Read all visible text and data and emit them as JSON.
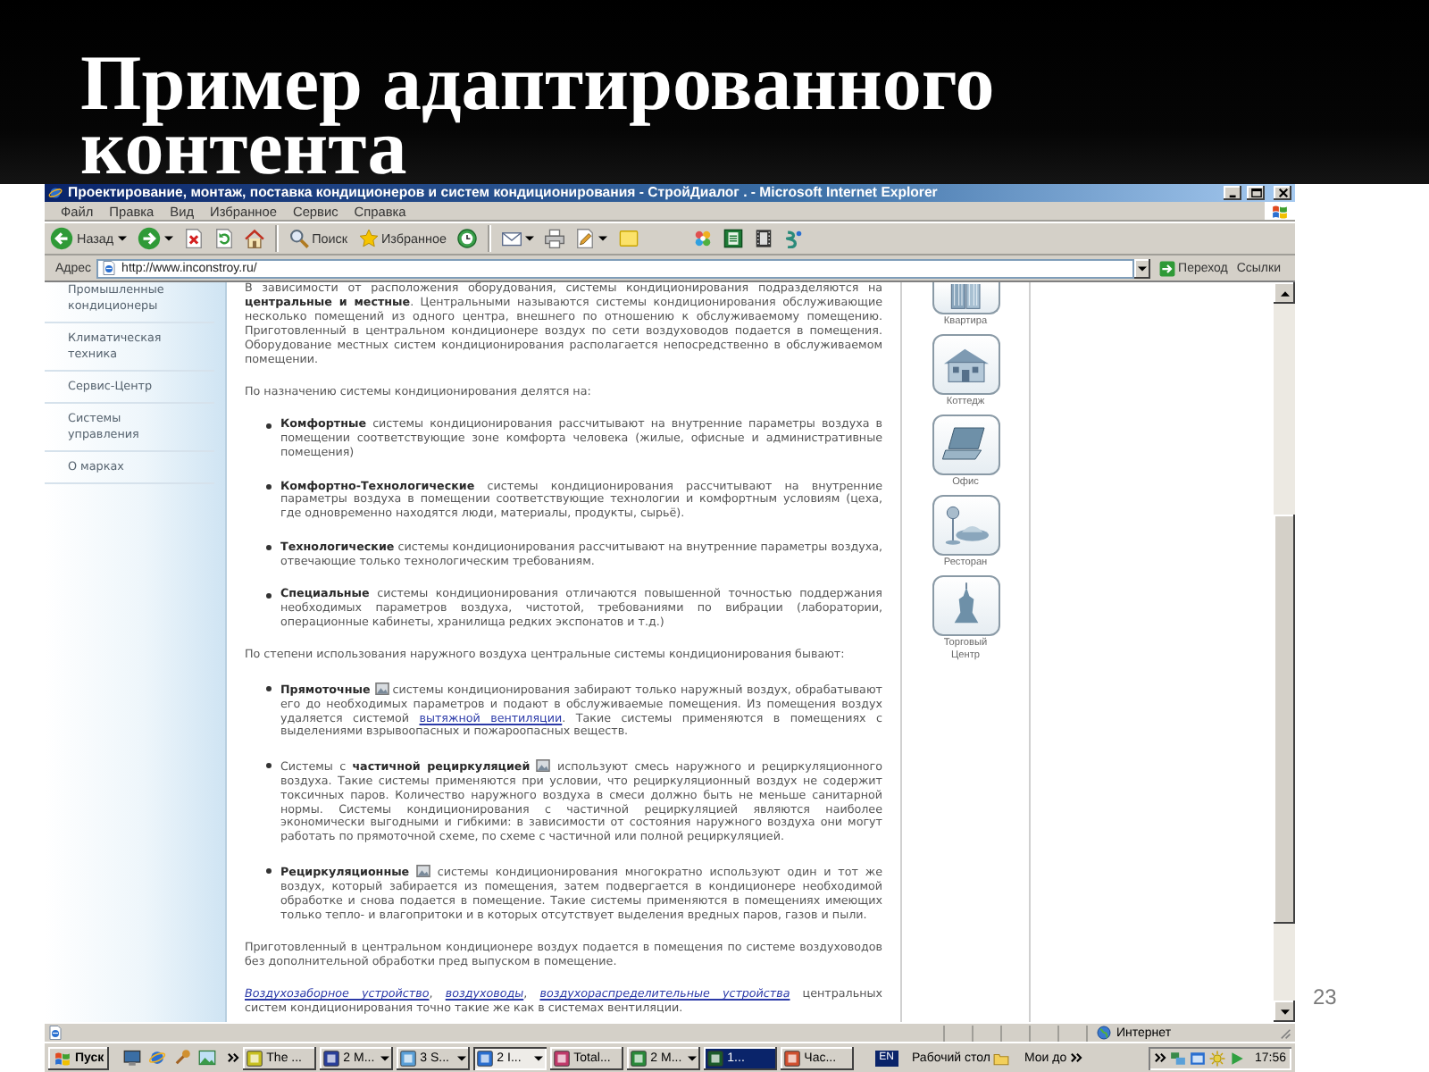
{
  "slide": {
    "title": "Пример адаптированного контента",
    "page_number": "23"
  },
  "browser": {
    "title": "Проектирование, монтаж, поставка кондиционеров и систем кондиционирования - СтройДиалог . - Microsoft Internet Explorer",
    "menu": [
      "Файл",
      "Правка",
      "Вид",
      "Избранное",
      "Сервис",
      "Справка"
    ],
    "toolbar": {
      "back": "Назад",
      "search": "Поиск",
      "favorites": "Избранное"
    },
    "address_bar": {
      "label": "Адрес",
      "value": "http://www.inconstroy.ru/",
      "go": "Переход",
      "links": "Ссылки"
    },
    "sidebar": {
      "items": [
        "Промышленные кондиционеры",
        "Климатическая техника",
        "Сервис-Центр",
        "Системы управления",
        "О марках"
      ]
    },
    "article": {
      "blocks": [
        {
          "kind": "paragraph",
          "segments": [
            {
              "kind": "text",
              "text": "В зависимости от расположения оборудования, системы кондиционирования подразделяются на **центральные и местные**. Центральными называются системы кондиционирования обслуживающие несколько помещений из одного центра, внешнего по отношению к обслуживаемому помещению. Приготовленный в центральном кондиционере воздух по сети воздуховодов подается в помещения. Оборудование местных систем кондиционирования располагается непосредственно в обслуживаемом помещении."
            }
          ]
        },
        {
          "kind": "paragraph",
          "segments": [
            {
              "kind": "text",
              "text": "По назначению системы кондиционирования делятся на:"
            }
          ]
        },
        {
          "kind": "bullet",
          "segments": [
            {
              "kind": "text",
              "text": "**Комфортные** системы кондиционирования рассчитывают на внутренние параметры воздуха в помещении соответствующие зоне комфорта человека (жилые, офисные и административные помещения)"
            }
          ]
        },
        {
          "kind": "bullet",
          "segments": [
            {
              "kind": "text",
              "text": "**Комфортно-Технологические** системы кондиционирования рассчитывают на внутренние параметры воздуха в помещении соответствующие технологии и комфортным условиям (цеха, где одновременно находятся люди, материалы, продукты, сырьё)."
            }
          ]
        },
        {
          "kind": "bullet",
          "segments": [
            {
              "kind": "text",
              "text": "**Технологические** системы кондиционирования рассчитывают на внутренние параметры воздуха, отвечающие только технологическим требованиям."
            }
          ]
        },
        {
          "kind": "bullet",
          "segments": [
            {
              "kind": "text",
              "text": "**Специальные** системы кондиционирования отличаются повышенной точностью поддержания необходимых параметров воздуха, чистотой, требованиями по вибрации (лаборатории, операционные кабинеты, хранилища редких экспонатов и т.д.)"
            }
          ]
        },
        {
          "kind": "paragraph",
          "segments": [
            {
              "kind": "text",
              "text": "По степени использования наружного воздуха центральные системы кондиционирования бывают:"
            }
          ]
        },
        {
          "kind": "bullet",
          "segments": [
            {
              "kind": "text",
              "text": "**Прямоточные** "
            },
            {
              "kind": "icon"
            },
            {
              "kind": "text",
              "text": " системы кондиционирования забирают только наружный воздух, обрабатывают его до необходимых параметров и подают в обслуживаемые помещения. Из помещения воздух удаляется системой "
            },
            {
              "kind": "link",
              "text": "вытяжной вентиляции"
            },
            {
              "kind": "text",
              "text": ". Такие системы применяются в помещениях с выделениями взрывоопасных и пожароопасных веществ."
            }
          ]
        },
        {
          "kind": "bullet",
          "segments": [
            {
              "kind": "text",
              "text": "Системы с **частичной рециркуляцией** "
            },
            {
              "kind": "icon"
            },
            {
              "kind": "text",
              "text": " используют смесь наружного и рециркуляционного воздуха. Такие системы применяются при условии, что рециркуляционный воздух не содержит токсичных паров. Количество наружного воздуха в смеси должно быть не меньше санитарной нормы. Системы кондиционирования с частичной рециркуляцией являются наиболее экономически выгодными и гибкими: в зависимости от состояния наружного воздуха они могут работать по прямоточной схеме, по схеме с частичной или полной рециркуляцией."
            }
          ]
        },
        {
          "kind": "bullet",
          "segments": [
            {
              "kind": "text",
              "text": "**Рециркуляционные** "
            },
            {
              "kind": "icon"
            },
            {
              "kind": "text",
              "text": " системы кондиционирования многократно используют один и тот же воздух, который забирается из помещения, затем подвергается в кондиционере необходимой обработке и снова подается в помещение. Такие системы применяются в помещениях имеющих только тепло- и влагопритоки и в которых отсутствует выделения вредных паров, газов и пыли."
            }
          ]
        },
        {
          "kind": "paragraph",
          "segments": [
            {
              "kind": "text",
              "text": "Приготовленный в центральном кондиционере воздух подается в помещения по системе воздуховодов без дополнительной обработки пред выпуском в помещение."
            }
          ]
        },
        {
          "kind": "paragraph",
          "segments": [
            {
              "kind": "link_italic",
              "text": "Воздухозаборное устройство"
            },
            {
              "kind": "text",
              "text": ", "
            },
            {
              "kind": "link_italic",
              "text": "воздуховоды"
            },
            {
              "kind": "text",
              "text": ", "
            },
            {
              "kind": "link_italic",
              "text": "воздухораспределительные устройства"
            },
            {
              "kind": "text",
              "text": " центральных систем кондиционирования точно такие же как в системах вентиляции."
            }
          ]
        }
      ]
    },
    "categories": [
      {
        "label": "Квартира"
      },
      {
        "label": "Коттедж"
      },
      {
        "label": "Офис"
      },
      {
        "label": "Ресторан"
      },
      {
        "label": "Торговый Центр"
      }
    ],
    "status_bar": {
      "zone": "Интернет"
    }
  },
  "taskbar": {
    "start": "Пуск",
    "tasks": [
      {
        "label": "The ...",
        "grouped": false,
        "selected": false,
        "flashing": false
      },
      {
        "label": "2 M...",
        "grouped": true,
        "selected": false,
        "flashing": false
      },
      {
        "label": "3 S...",
        "grouped": true,
        "selected": false,
        "flashing": false
      },
      {
        "label": "2 I...",
        "grouped": true,
        "selected": true,
        "flashing": false
      },
      {
        "label": "Total...",
        "grouped": false,
        "selected": false,
        "flashing": false
      },
      {
        "label": "2 M...",
        "grouped": true,
        "selected": false,
        "flashing": false
      },
      {
        "label": "1...",
        "grouped": false,
        "selected": false,
        "flashing": true
      },
      {
        "label": "Час...",
        "grouped": false,
        "selected": false,
        "flashing": false
      }
    ],
    "language": "EN",
    "desktop_toolbar": "Рабочий стол",
    "documents_toolbar": "Мои до",
    "clock": "17:56"
  }
}
